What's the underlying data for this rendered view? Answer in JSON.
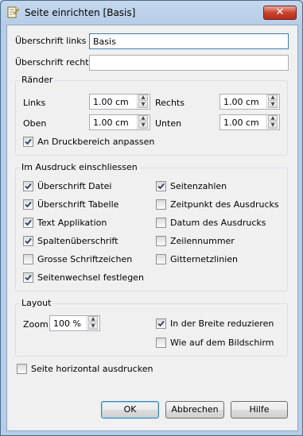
{
  "window": {
    "title": "Seite einrichten [Basis]",
    "close_glyph": "✕"
  },
  "header": {
    "ueberschrift_links_label": "Überschrift links",
    "ueberschrift_links_value": "Basis",
    "ueberschrift_rechts_label": "Überschrift rechts",
    "ueberschrift_rechts_value": ""
  },
  "raender": {
    "title": "Ränder",
    "links_label": "Links",
    "links_value": "1.00 cm",
    "rechts_label": "Rechts",
    "rechts_value": "1.00 cm",
    "oben_label": "Oben",
    "oben_value": "1.00 cm",
    "unten_label": "Unten",
    "unten_value": "1.00 cm",
    "druckbereich_label": "An Druckbereich anpassen",
    "druckbereich_checked": true
  },
  "ausdruck": {
    "title": "Im Ausdruck einschliessen",
    "left": [
      {
        "label": "Überschrift Datei",
        "checked": true
      },
      {
        "label": "Überschrift Tabelle",
        "checked": true
      },
      {
        "label": "Text Applikation",
        "checked": true
      },
      {
        "label": "Spaltenüberschrift",
        "checked": true
      },
      {
        "label": "Grosse Schriftzeichen",
        "checked": false
      },
      {
        "label": "Seitenwechsel festlegen",
        "checked": true
      }
    ],
    "right": [
      {
        "label": "Seitenzahlen",
        "checked": true
      },
      {
        "label": "Zeitpunkt des Ausdrucks",
        "checked": false
      },
      {
        "label": "Datum des Ausdrucks",
        "checked": false
      },
      {
        "label": "Zeilennummer",
        "checked": false
      },
      {
        "label": "Gitternetzlinien",
        "checked": false
      }
    ]
  },
  "layout": {
    "title": "Layout",
    "zoom_label": "Zoom",
    "zoom_value": "100 %",
    "breite_label": "In der Breite reduzieren",
    "breite_checked": true,
    "bildschirm_label": "Wie auf dem Bildschirm",
    "bildschirm_checked": false
  },
  "horizontal": {
    "label": "Seite horizontal ausdrucken",
    "checked": false
  },
  "buttons": {
    "ok": "OK",
    "abbrechen": "Abbrechen",
    "hilfe": "Hilfe"
  }
}
